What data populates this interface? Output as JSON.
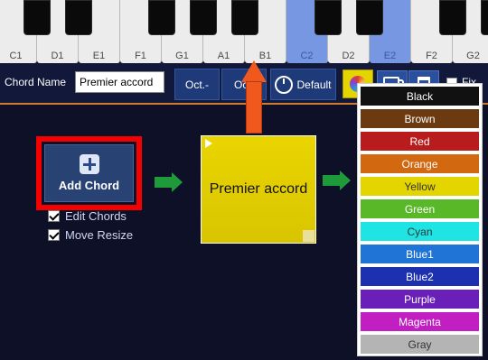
{
  "keyboard": {
    "white_keys": [
      {
        "label": "C1",
        "selected": false
      },
      {
        "label": "D1",
        "selected": false
      },
      {
        "label": "E1",
        "selected": false
      },
      {
        "label": "F1",
        "selected": false
      },
      {
        "label": "G1",
        "selected": false
      },
      {
        "label": "A1",
        "selected": false
      },
      {
        "label": "B1",
        "selected": false
      },
      {
        "label": "C2",
        "selected": true
      },
      {
        "label": "D2",
        "selected": false
      },
      {
        "label": "E2",
        "selected": true
      },
      {
        "label": "F2",
        "selected": false
      },
      {
        "label": "G2",
        "selected": false
      }
    ],
    "selected_color": "#7797e2"
  },
  "toolbar": {
    "chord_name_label": "Chord Name",
    "chord_name_value": "Premier accord",
    "oct_minus_label": "Oct.-",
    "oct_plus_label": "Oct.",
    "default_label": "Default",
    "fix_label": "Fix"
  },
  "editor": {
    "add_chord_label": "Add Chord",
    "edit_chords_label": "Edit Chords",
    "edit_chords_checked": true,
    "move_resize_label": "Move Resize",
    "move_resize_checked": true,
    "chord_block_text": "Premier accord",
    "chord_block_color": "#e4d400"
  },
  "color_menu": {
    "items": [
      {
        "label": "Black",
        "bg": "#111111",
        "fg": "#ffffff"
      },
      {
        "label": "Brown",
        "bg": "#6b3a10",
        "fg": "#ffffff"
      },
      {
        "label": "Red",
        "bg": "#b81c1c",
        "fg": "#ffffff"
      },
      {
        "label": "Orange",
        "bg": "#d2680f",
        "fg": "#ffffff"
      },
      {
        "label": "Yellow",
        "bg": "#e4d400",
        "fg": "#333333"
      },
      {
        "label": "Green",
        "bg": "#58b828",
        "fg": "#ffffff"
      },
      {
        "label": "Cyan",
        "bg": "#1ee4e4",
        "fg": "#333333"
      },
      {
        "label": "Blue1",
        "bg": "#1f74d6",
        "fg": "#ffffff"
      },
      {
        "label": "Blue2",
        "bg": "#1c30b0",
        "fg": "#ffffff"
      },
      {
        "label": "Purple",
        "bg": "#6a1fb8",
        "fg": "#ffffff"
      },
      {
        "label": "Magenta",
        "bg": "#c21fc2",
        "fg": "#ffffff"
      },
      {
        "label": "Gray",
        "bg": "#b4b4b4",
        "fg": "#333333"
      }
    ]
  }
}
